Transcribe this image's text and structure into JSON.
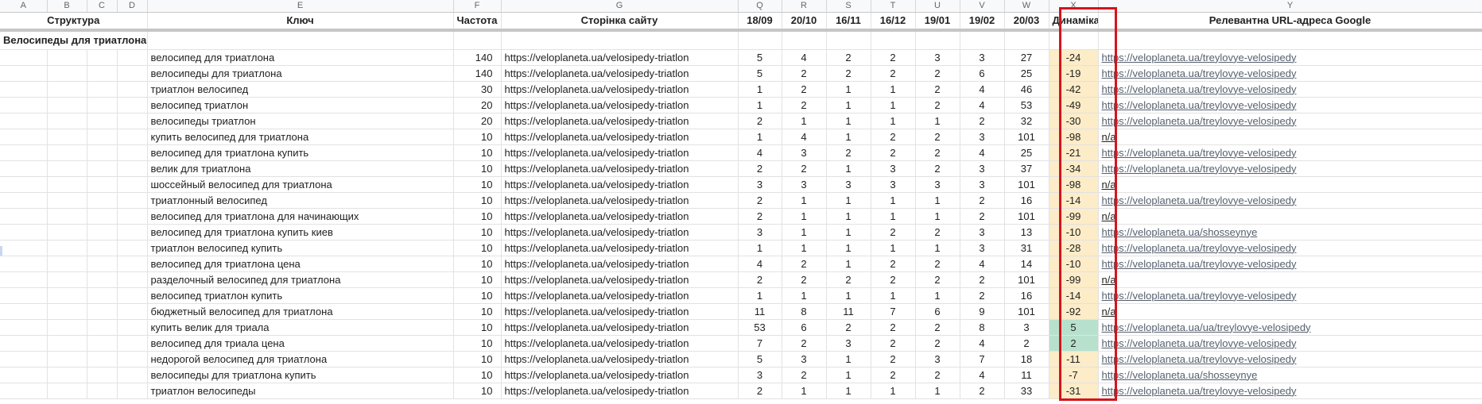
{
  "columns": [
    "A",
    "B",
    "C",
    "D",
    "E",
    "F",
    "G",
    "Q",
    "R",
    "S",
    "T",
    "U",
    "V",
    "W",
    "X",
    "Y"
  ],
  "headers": {
    "structure": "Структура",
    "key": "Ключ",
    "frequency": "Частота",
    "page": "Сторінка сайту",
    "dates": [
      "18/09",
      "20/10",
      "16/11",
      "16/12",
      "19/01",
      "19/02",
      "20/03"
    ],
    "dynamics": "Динаміка",
    "relevant_url": "Релевантна URL-адреса Google"
  },
  "group_title": "Велосипеды для триатлона",
  "rows": [
    {
      "key": "велосипед для триатлона",
      "freq": "140",
      "page": "https://veloplaneta.ua/velosipedy-triatlon",
      "p": [
        "5",
        "4",
        "2",
        "2",
        "3",
        "3",
        "27"
      ],
      "dyn": "-24",
      "url": "https://veloplaneta.ua/treylovye-velosipedy"
    },
    {
      "key": "велосипеды для триатлона",
      "freq": "140",
      "page": "https://veloplaneta.ua/velosipedy-triatlon",
      "p": [
        "5",
        "2",
        "2",
        "2",
        "2",
        "6",
        "25"
      ],
      "dyn": "-19",
      "url": "https://veloplaneta.ua/treylovye-velosipedy"
    },
    {
      "key": "триатлон велосипед",
      "freq": "30",
      "page": "https://veloplaneta.ua/velosipedy-triatlon",
      "p": [
        "1",
        "2",
        "1",
        "1",
        "2",
        "4",
        "46"
      ],
      "dyn": "-42",
      "url": "https://veloplaneta.ua/treylovye-velosipedy"
    },
    {
      "key": "велосипед триатлон",
      "freq": "20",
      "page": "https://veloplaneta.ua/velosipedy-triatlon",
      "p": [
        "1",
        "2",
        "1",
        "1",
        "2",
        "4",
        "53"
      ],
      "dyn": "-49",
      "url": "https://veloplaneta.ua/treylovye-velosipedy"
    },
    {
      "key": "велосипеды триатлон",
      "freq": "20",
      "page": "https://veloplaneta.ua/velosipedy-triatlon",
      "p": [
        "2",
        "1",
        "1",
        "1",
        "1",
        "2",
        "32"
      ],
      "dyn": "-30",
      "url": "https://veloplaneta.ua/treylovye-velosipedy"
    },
    {
      "key": "купить велосипед для триатлона",
      "freq": "10",
      "page": "https://veloplaneta.ua/velosipedy-triatlon",
      "p": [
        "1",
        "4",
        "1",
        "2",
        "2",
        "3",
        "101"
      ],
      "dyn": "-98",
      "url": "n/a"
    },
    {
      "key": "велосипед для триатлона купить",
      "freq": "10",
      "page": "https://veloplaneta.ua/velosipedy-triatlon",
      "p": [
        "4",
        "3",
        "2",
        "2",
        "2",
        "4",
        "25"
      ],
      "dyn": "-21",
      "url": "https://veloplaneta.ua/treylovye-velosipedy"
    },
    {
      "key": "велик для триатлона",
      "freq": "10",
      "page": "https://veloplaneta.ua/velosipedy-triatlon",
      "p": [
        "2",
        "2",
        "1",
        "3",
        "2",
        "3",
        "37"
      ],
      "dyn": "-34",
      "url": "https://veloplaneta.ua/treylovye-velosipedy"
    },
    {
      "key": "шоссейный велосипед для триатлона",
      "freq": "10",
      "page": "https://veloplaneta.ua/velosipedy-triatlon",
      "p": [
        "3",
        "3",
        "3",
        "3",
        "3",
        "3",
        "101"
      ],
      "dyn": "-98",
      "url": "n/a"
    },
    {
      "key": "триатлонный велосипед",
      "freq": "10",
      "page": "https://veloplaneta.ua/velosipedy-triatlon",
      "p": [
        "2",
        "1",
        "1",
        "1",
        "1",
        "2",
        "16"
      ],
      "dyn": "-14",
      "url": "https://veloplaneta.ua/treylovye-velosipedy"
    },
    {
      "key": "велосипед для триатлона для начинающих",
      "freq": "10",
      "page": "https://veloplaneta.ua/velosipedy-triatlon",
      "p": [
        "2",
        "1",
        "1",
        "1",
        "1",
        "2",
        "101"
      ],
      "dyn": "-99",
      "url": "n/a"
    },
    {
      "key": "велосипед для триатлона купить киев",
      "freq": "10",
      "page": "https://veloplaneta.ua/velosipedy-triatlon",
      "p": [
        "3",
        "1",
        "1",
        "2",
        "2",
        "3",
        "13"
      ],
      "dyn": "-10",
      "url": "https://veloplaneta.ua/shosseynye"
    },
    {
      "key": "триатлон велосипед купить",
      "freq": "10",
      "page": "https://veloplaneta.ua/velosipedy-triatlon",
      "p": [
        "1",
        "1",
        "1",
        "1",
        "1",
        "3",
        "31"
      ],
      "dyn": "-28",
      "url": "https://veloplaneta.ua/treylovye-velosipedy"
    },
    {
      "key": "велосипед для триатлона цена",
      "freq": "10",
      "page": "https://veloplaneta.ua/velosipedy-triatlon",
      "p": [
        "4",
        "2",
        "1",
        "2",
        "2",
        "4",
        "14"
      ],
      "dyn": "-10",
      "url": "https://veloplaneta.ua/treylovye-velosipedy"
    },
    {
      "key": "разделочный велосипед для триатлона",
      "freq": "10",
      "page": "https://veloplaneta.ua/velosipedy-triatlon",
      "p": [
        "2",
        "2",
        "2",
        "2",
        "2",
        "2",
        "101"
      ],
      "dyn": "-99",
      "url": "n/a"
    },
    {
      "key": "велосипед триатлон купить",
      "freq": "10",
      "page": "https://veloplaneta.ua/velosipedy-triatlon",
      "p": [
        "1",
        "1",
        "1",
        "1",
        "1",
        "2",
        "16"
      ],
      "dyn": "-14",
      "url": "https://veloplaneta.ua/treylovye-velosipedy"
    },
    {
      "key": "бюджетный велосипед для триатлона",
      "freq": "10",
      "page": "https://veloplaneta.ua/velosipedy-triatlon",
      "p": [
        "11",
        "8",
        "11",
        "7",
        "6",
        "9",
        "101"
      ],
      "dyn": "-92",
      "url": "n/a"
    },
    {
      "key": "купить велик для триала",
      "freq": "10",
      "page": "https://veloplaneta.ua/velosipedy-triatlon",
      "p": [
        "53",
        "6",
        "2",
        "2",
        "2",
        "8",
        "3"
      ],
      "dyn": "5",
      "url": "https://veloplaneta.ua/ua/treylovye-velosipedy"
    },
    {
      "key": "велосипед для триала цена",
      "freq": "10",
      "page": "https://veloplaneta.ua/velosipedy-triatlon",
      "p": [
        "7",
        "2",
        "3",
        "2",
        "2",
        "4",
        "2"
      ],
      "dyn": "2",
      "url": "https://veloplaneta.ua/treylovye-velosipedy"
    },
    {
      "key": "недорогой велосипед для триатлона",
      "freq": "10",
      "page": "https://veloplaneta.ua/velosipedy-triatlon",
      "p": [
        "5",
        "3",
        "1",
        "2",
        "3",
        "7",
        "18"
      ],
      "dyn": "-11",
      "url": "https://veloplaneta.ua/treylovye-velosipedy"
    },
    {
      "key": "велосипеды для триатлона купить",
      "freq": "10",
      "page": "https://veloplaneta.ua/velosipedy-triatlon",
      "p": [
        "3",
        "2",
        "1",
        "2",
        "2",
        "4",
        "11"
      ],
      "dyn": "-7",
      "url": "https://veloplaneta.ua/shosseynye"
    },
    {
      "key": "триатлон велосипеды",
      "freq": "10",
      "page": "https://veloplaneta.ua/velosipedy-triatlon",
      "p": [
        "2",
        "1",
        "1",
        "1",
        "1",
        "2",
        "33"
      ],
      "dyn": "-31",
      "url": "https://veloplaneta.ua/treylovye-velosipedy"
    }
  ],
  "colors": {
    "highlight_box": "#d5141c",
    "dyn_negative": "#fcecc8",
    "dyn_positive": "#b7e1cd",
    "link": "#56606e"
  }
}
